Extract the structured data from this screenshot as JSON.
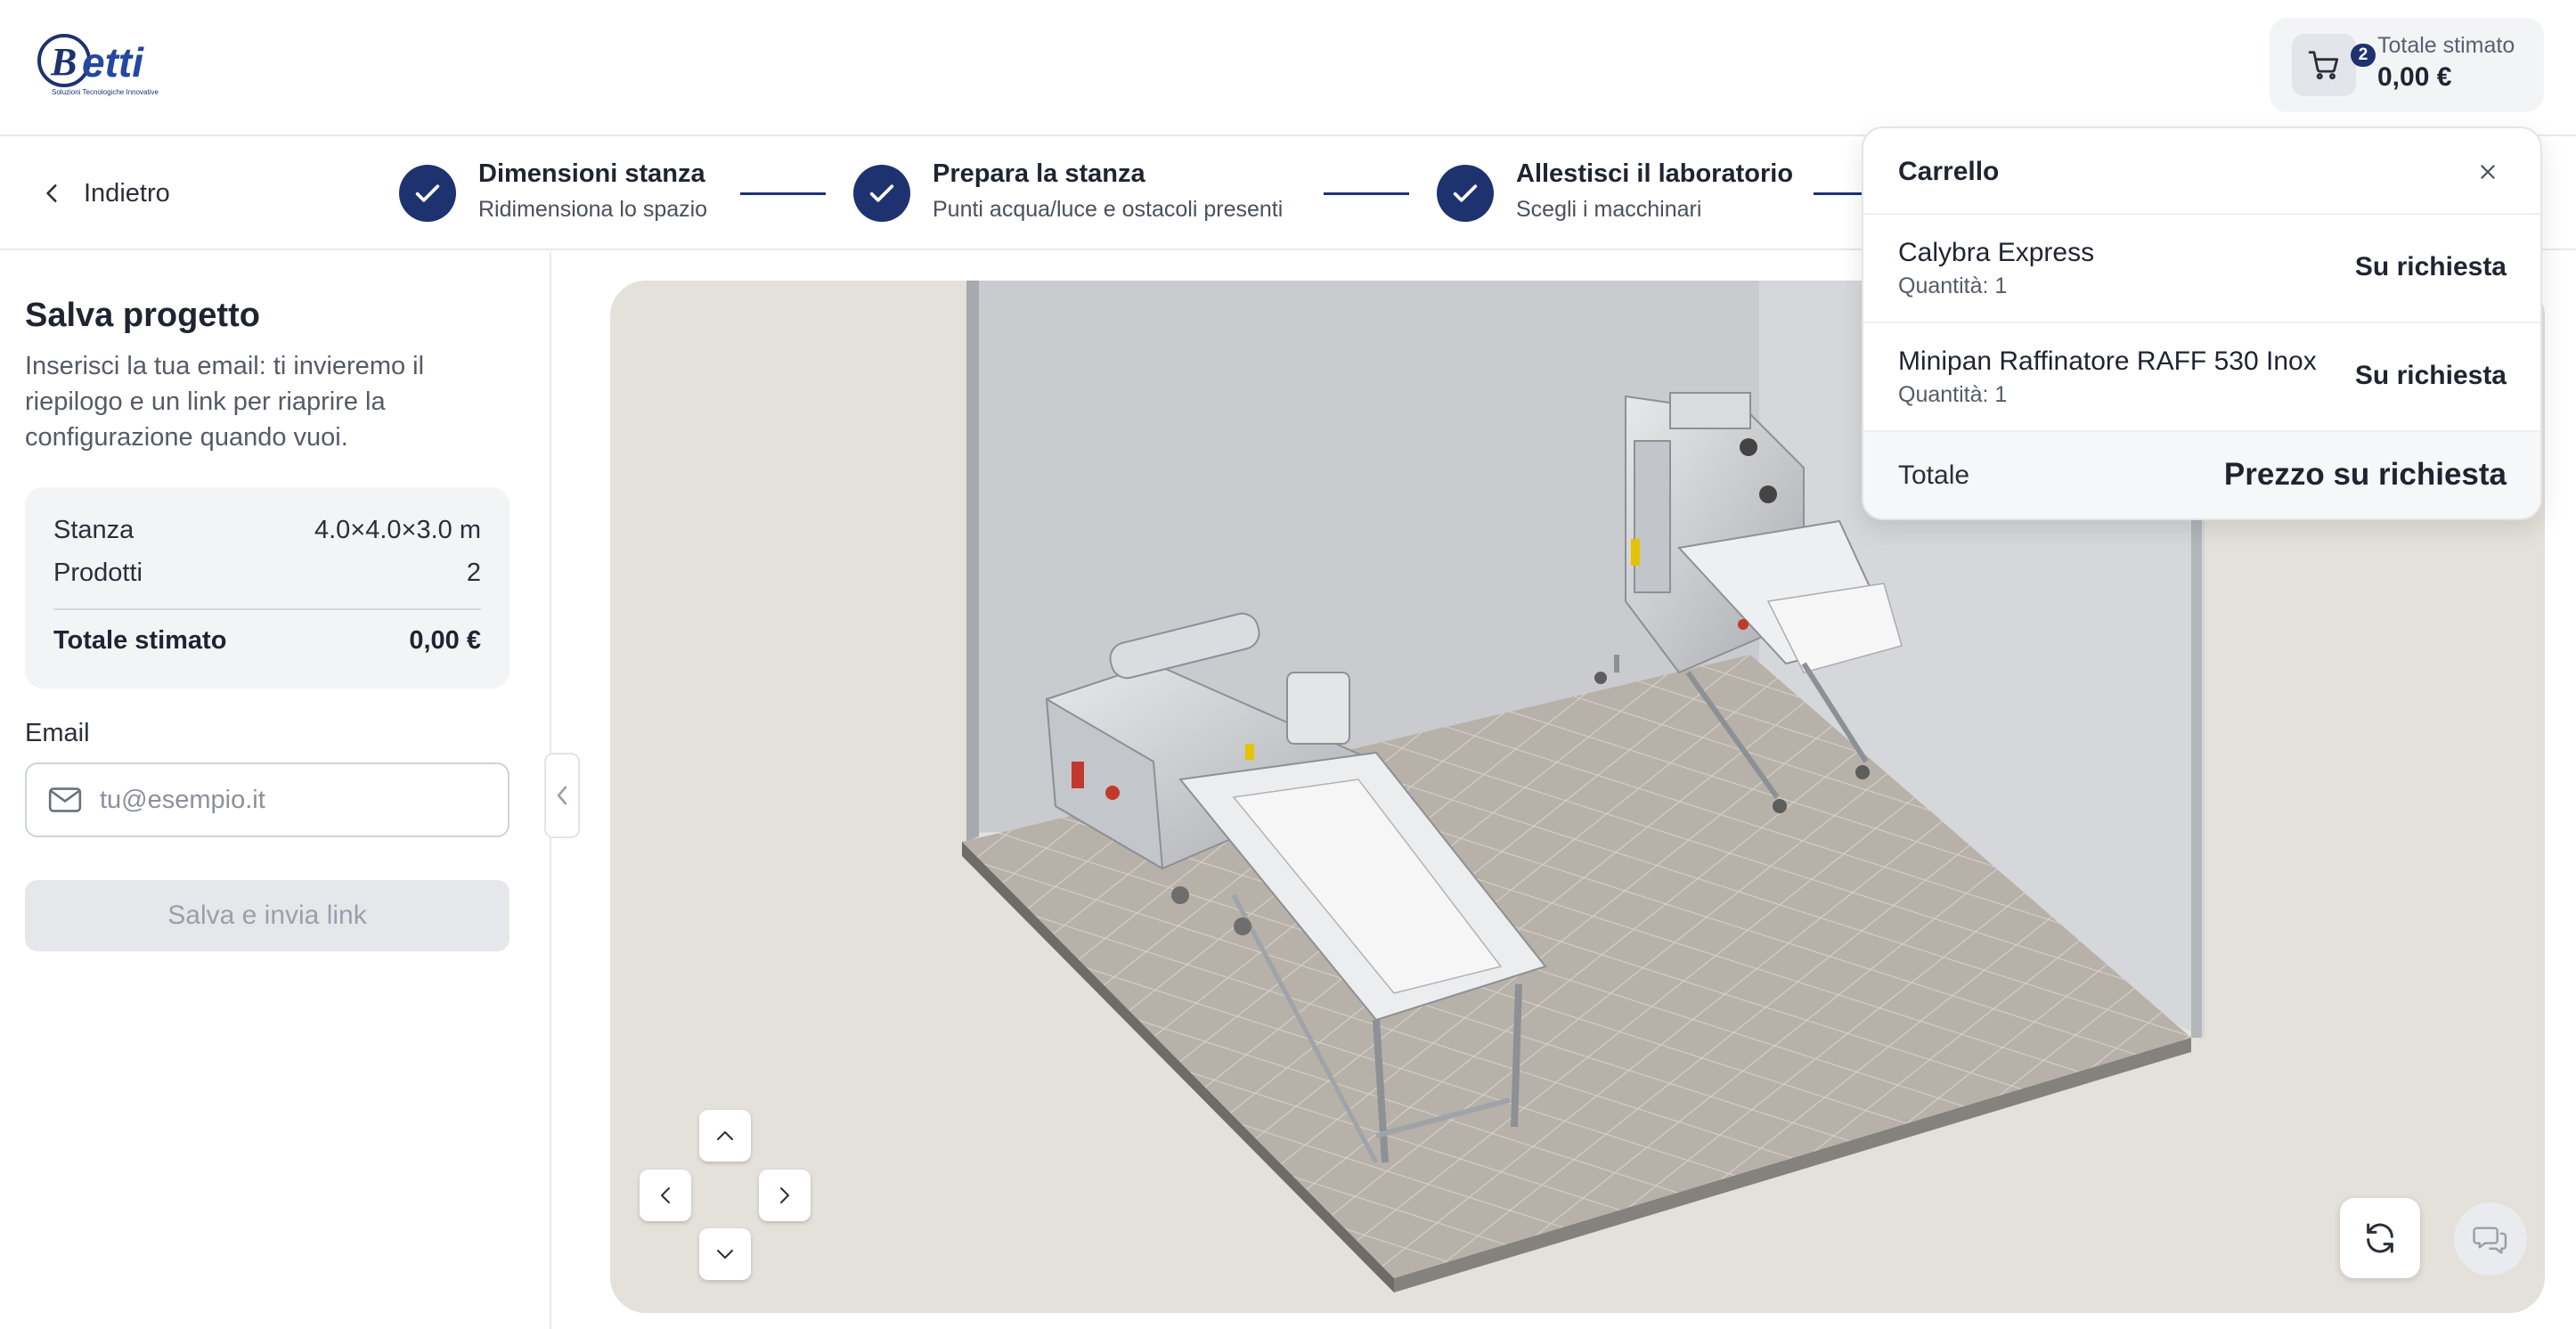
{
  "header": {
    "logo_text": "Betti",
    "logo_tagline": "Soluzioni Tecnologiche Innovative",
    "cart": {
      "badge_count": "2",
      "label": "Totale stimato",
      "value": "0,00 €",
      "icon": "cart-icon"
    }
  },
  "stepper": {
    "back_label": "Indietro",
    "steps": [
      {
        "title": "Dimensioni stanza",
        "subtitle": "Ridimensiona lo spazio",
        "status": "completed"
      },
      {
        "title": "Prepara la stanza",
        "subtitle": "Punti acqua/luce e ostacoli presenti",
        "status": "completed"
      },
      {
        "title": "Allestisci il laboratorio",
        "subtitle": "Scegli i macchinari",
        "status": "completed"
      }
    ]
  },
  "save_panel": {
    "title": "Salva progetto",
    "description": "Inserisci la tua email: ti invieremo il riepilogo e un link per riaprire la configurazione quando vuoi.",
    "summary": {
      "room_label": "Stanza",
      "room_value": "4.0×4.0×3.0 m",
      "products_label": "Prodotti",
      "products_value": "2",
      "total_label": "Totale stimato",
      "total_value": "0,00 €"
    },
    "email_label": "Email",
    "email_value": "",
    "email_placeholder": "tu@esempio.it",
    "submit_label": "Salva e invia link"
  },
  "cart_popover": {
    "title": "Carrello",
    "items": [
      {
        "name": "Calybra Express",
        "quantity": "Quantità: 1",
        "price": "Su richiesta"
      },
      {
        "name": "Minipan Raffinatore RAFF 530 Inox",
        "quantity": "Quantità: 1",
        "price": "Su richiesta"
      }
    ],
    "total_label": "Totale",
    "total_value": "Prezzo su richiesta"
  },
  "colors": {
    "brand": "#1e3270",
    "viewport_bg": "#e4e0da",
    "floor": "#b4aea7",
    "wall": "#cfd1d4"
  }
}
